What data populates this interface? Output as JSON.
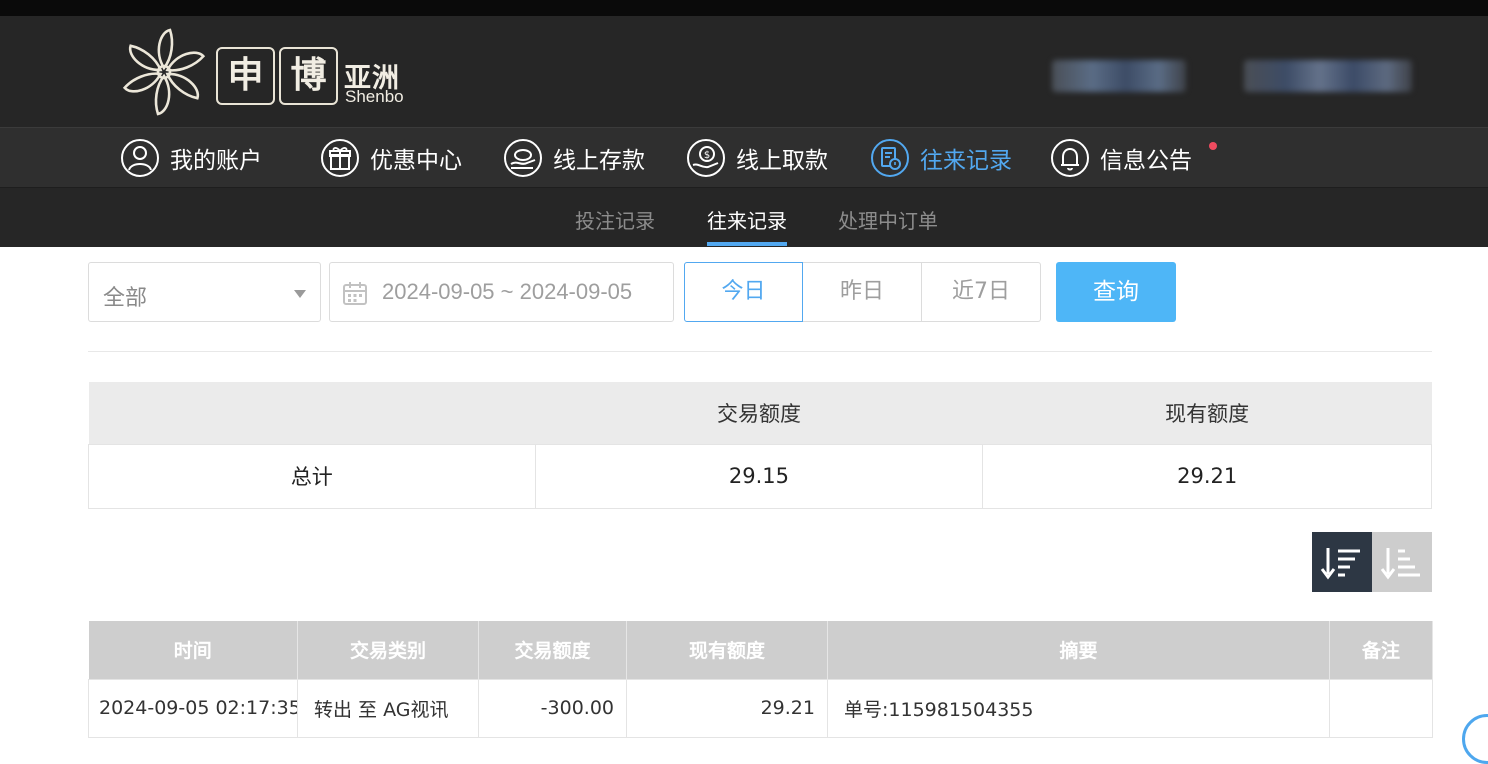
{
  "brand": {
    "logo_cn_box1": "申",
    "logo_cn_box2": "博",
    "logo_cn_suffix": "亚洲",
    "logo_en": "Shenbo"
  },
  "main_nav": [
    {
      "label": "我的账户",
      "icon": "user-icon",
      "active": false
    },
    {
      "label": "优惠中心",
      "icon": "gift-icon",
      "active": false
    },
    {
      "label": "线上存款",
      "icon": "deposit-icon",
      "active": false
    },
    {
      "label": "线上取款",
      "icon": "withdraw-icon",
      "active": false
    },
    {
      "label": "往来记录",
      "icon": "records-icon",
      "active": true
    },
    {
      "label": "信息公告",
      "icon": "bell-icon",
      "active": false,
      "badge": true
    }
  ],
  "sub_nav": [
    {
      "label": "投注记录",
      "active": false
    },
    {
      "label": "往来记录",
      "active": true
    },
    {
      "label": "处理中订单",
      "active": false
    }
  ],
  "filters": {
    "type_select": "全部",
    "date_range": "2024-09-05 ~ 2024-09-05",
    "quick_ranges": [
      "今日",
      "昨日",
      "近7日"
    ],
    "selected_range": "今日",
    "query_label": "查询"
  },
  "summary": {
    "headers": [
      "",
      "交易额度",
      "现有额度"
    ],
    "row": [
      "总计",
      "29.15",
      "29.21"
    ]
  },
  "records": {
    "headers": [
      "时间",
      "交易类别",
      "交易额度",
      "现有额度",
      "摘要",
      "备注"
    ],
    "rows": [
      [
        "2024-09-05 02:17:35",
        "转出 至 AG视讯",
        "-300.00",
        "29.21",
        "单号:115981504355",
        ""
      ]
    ]
  },
  "colors": {
    "accent": "#52a8f0",
    "query_button": "#4eb6f7",
    "header_bg": "#262626",
    "badge": "#ef4b5f"
  }
}
